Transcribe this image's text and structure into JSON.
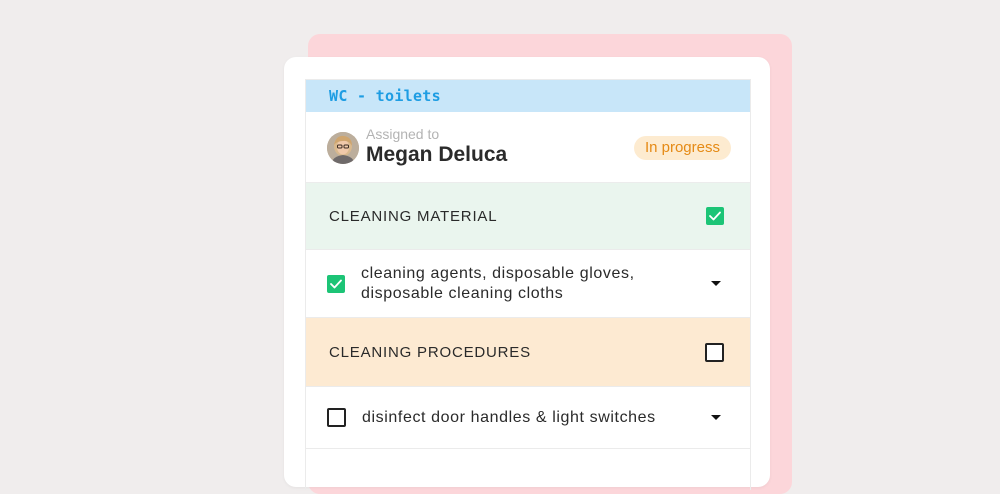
{
  "area": {
    "title": "WC - toilets"
  },
  "assignment": {
    "label": "Assigned to",
    "name": "Megan Deluca",
    "status": "In progress"
  },
  "sections": {
    "material": {
      "title": "CLEANING MATERIAL",
      "checked": true,
      "item": {
        "line1": "cleaning agents, disposable gloves,",
        "line2": "disposable cleaning cloths",
        "checked": true
      }
    },
    "procedures": {
      "title": "CLEANING PROCEDURES",
      "checked": false,
      "item": {
        "label": "disinfect door handles & light switches",
        "checked": false
      }
    }
  },
  "colors": {
    "page_bg": "#f0eded",
    "back_card": "#fcd6da",
    "area_header_bg": "#c8e6f9",
    "area_title": "#1e9de3",
    "status_bg": "#fdebd0",
    "status_text": "#e58a15",
    "material_bg": "#eaf5ee",
    "procedures_bg": "#fdead2",
    "check_green": "#1cc476"
  },
  "icons": {
    "checkmark": "check-icon",
    "dropdown": "caret-down-icon",
    "avatar": "user-avatar"
  }
}
